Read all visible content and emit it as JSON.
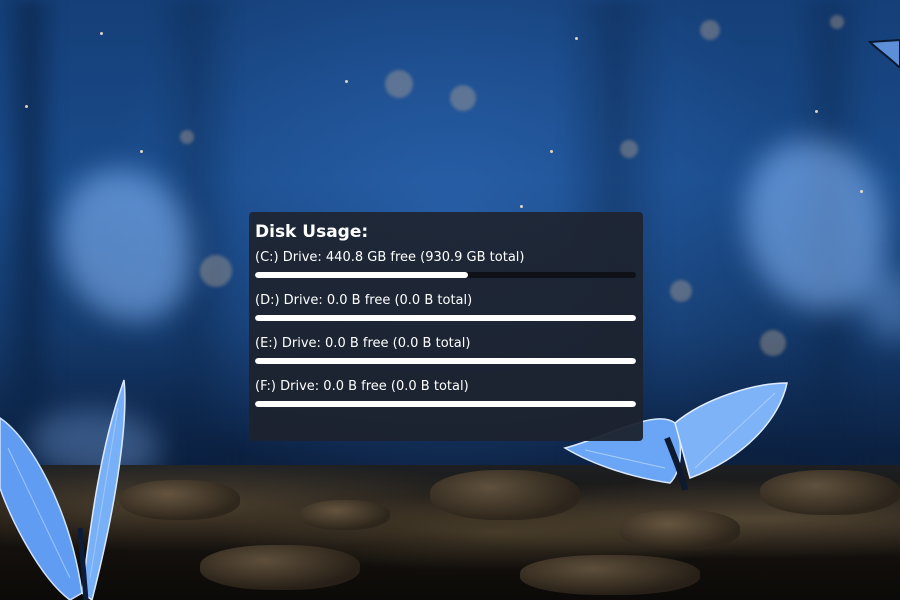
{
  "widget": {
    "title": "Disk Usage:",
    "drives": [
      {
        "label": "(C:) Drive: 440.8 GB free (930.9 GB total)",
        "used_fraction": 0.56
      },
      {
        "label": "(D:) Drive: 0.0 B free (0.0 B total)",
        "used_fraction": 1.0
      },
      {
        "label": "(E:) Drive: 0.0 B free (0.0 B total)",
        "used_fraction": 1.0
      },
      {
        "label": "(F:) Drive: 0.0 B free (0.0 B total)",
        "used_fraction": 1.0
      }
    ]
  },
  "colors": {
    "bar_fill": "#ffffff",
    "bar_track": "#0e1117",
    "widget_background": "#1e2430",
    "wallpaper_blue": "#1a4b8a"
  },
  "wallpaper": {
    "icon": "butterfly-forest-wallpaper"
  }
}
